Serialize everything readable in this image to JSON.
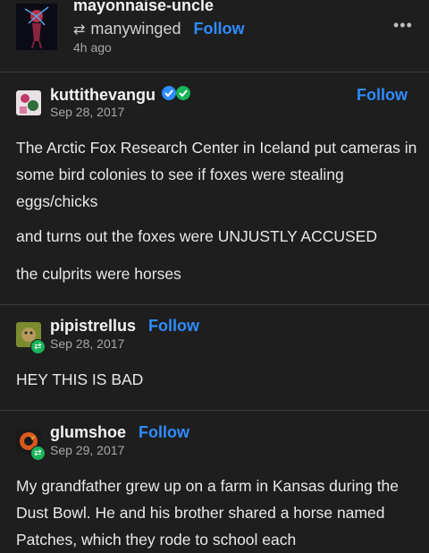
{
  "header": {
    "username": "mayonnaise-uncle",
    "reblogged_from": "manywinged",
    "follow_label": "Follow",
    "time_ago": "4h ago",
    "more_label": "•••"
  },
  "posts": [
    {
      "username": "kuttithevangu",
      "follow_label": "Follow",
      "date": "Sep 28, 2017",
      "paragraphs": [
        "The Arctic Fox Research Center in Iceland put cameras in some bird colonies to see if foxes were stealing eggs/chicks",
        "and turns out the foxes were UNJUSTLY ACCUSED",
        "the culprits were horses"
      ]
    },
    {
      "username": "pipistrellus",
      "follow_label": "Follow",
      "date": "Sep 28, 2017",
      "paragraphs": [
        "HEY THIS IS BAD"
      ]
    },
    {
      "username": "glumshoe",
      "follow_label": "Follow",
      "date": "Sep 29, 2017",
      "paragraphs": [
        "My grandfather grew up on a farm in Kansas during the Dust Bowl. He and his brother shared a horse named Patches, which they rode to school each"
      ]
    }
  ],
  "colors": {
    "background": "#1e1e1e",
    "follow_blue": "#2f8cff",
    "verified_blue": "#2f8cff",
    "verified_green": "#19b35a",
    "reblog_badge": "#19b35a"
  }
}
